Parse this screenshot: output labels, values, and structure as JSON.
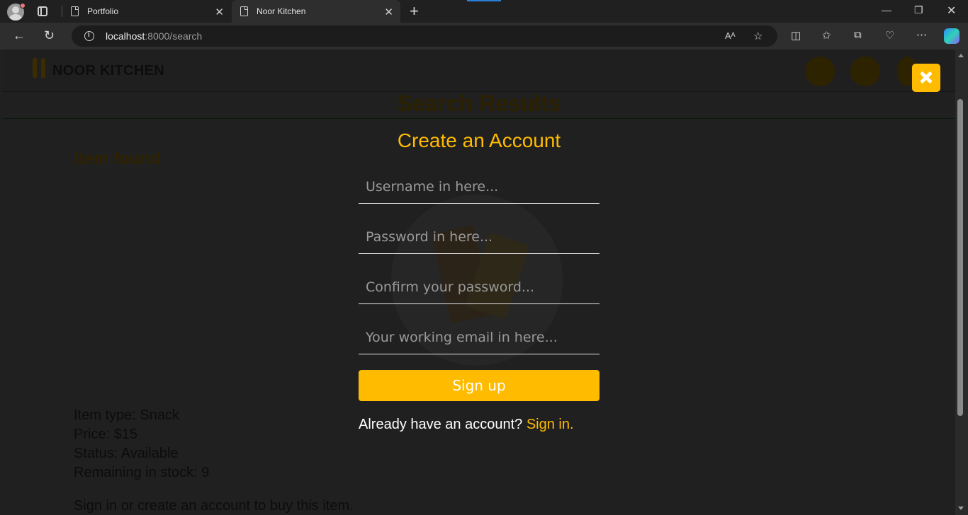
{
  "browser": {
    "tabs": [
      {
        "title": "Portfolio"
      },
      {
        "title": "Noor Kitchen"
      }
    ],
    "url_host": "localhost",
    "url_rest": ":8000/search"
  },
  "site": {
    "logo_text": "NOOR KITCHEN",
    "nav_icons": [
      "home-icon",
      "search-icon",
      "user-icon"
    ],
    "results_title": "Search Results",
    "found_text": "Item found",
    "details": {
      "type": "Item type: Snack",
      "price": "Price: $15",
      "status": "Status: Available",
      "stock": "Remaining in stock: 9",
      "signin_prompt": "Sign in or create an account to buy this item."
    }
  },
  "modal": {
    "title": "Create an Account",
    "username_placeholder": "Username in here...",
    "password_placeholder": "Password in here...",
    "confirm_placeholder": "Confirm your password...",
    "email_placeholder": "Your working email in here...",
    "signup_label": "Sign up",
    "have_account_text": "Already have an account?",
    "signin_link": "Sign in."
  },
  "colors": {
    "accent": "#ffbb00",
    "overlay_bg": "#202020"
  }
}
